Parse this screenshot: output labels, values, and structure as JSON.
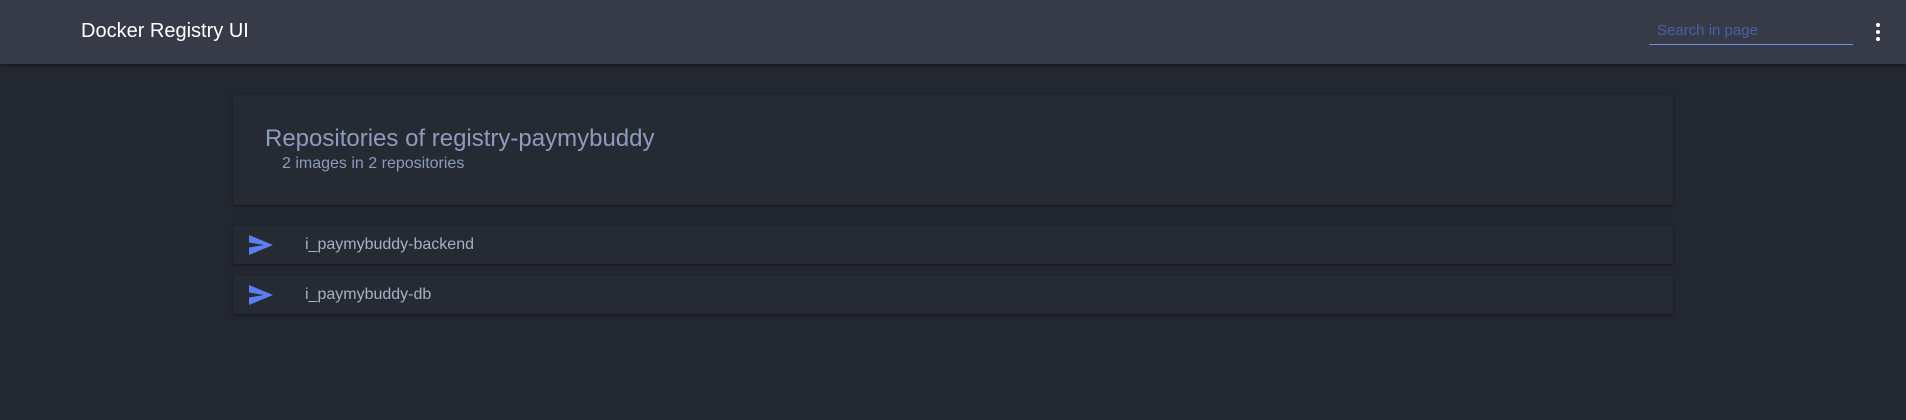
{
  "header": {
    "title": "Docker Registry UI",
    "search_placeholder": "Search in page",
    "menu_icon": "more-vert-icon"
  },
  "catalog": {
    "title": "Repositories of registry-paymybuddy",
    "subtitle": "2 images in 2 repositories"
  },
  "repositories": [
    {
      "name": "i_paymybuddy-backend",
      "icon": "send-icon"
    },
    {
      "name": "i_paymybuddy-db",
      "icon": "send-icon"
    }
  ],
  "colors": {
    "topbar": "#363b47",
    "background": "#232730",
    "card": "#262a33",
    "accent": "#6d8ef5",
    "icon": "#5b7ff2"
  }
}
